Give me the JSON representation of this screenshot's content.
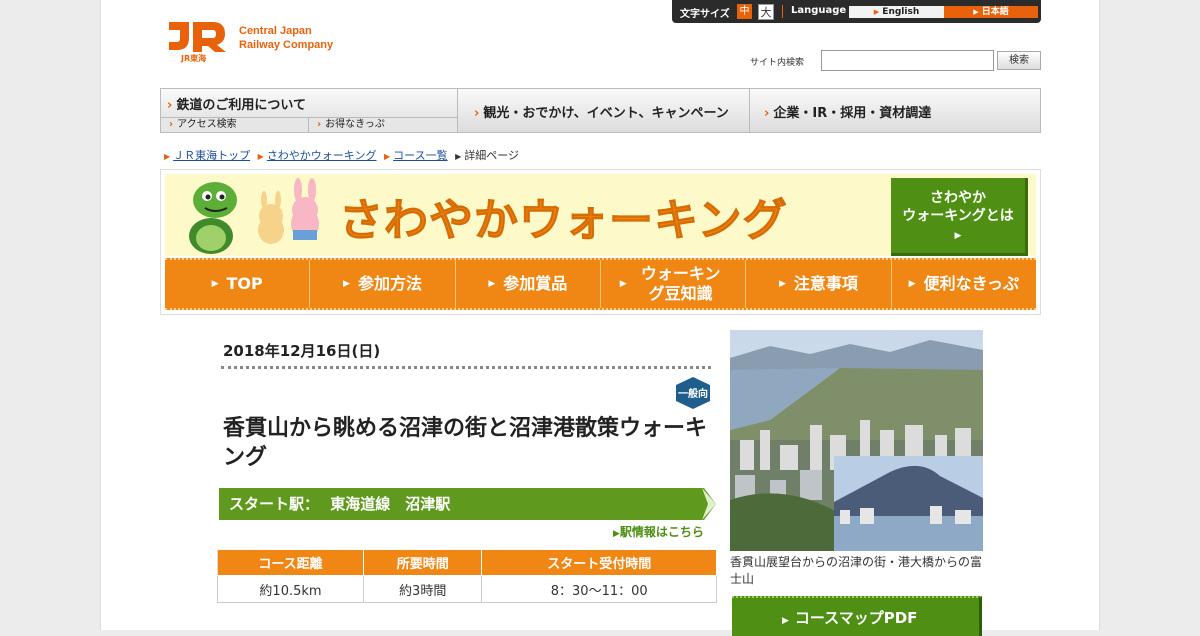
{
  "header": {
    "logo_mark_text": "JR東海",
    "company_name_line1": "Central Japan",
    "company_name_line2": "Railway Company",
    "font_size_label": "文字サイズ",
    "font_size_mid": "中",
    "font_size_large": "大",
    "language_label": "Language",
    "lang_english": "English",
    "lang_japanese": "日本語",
    "search_label": "サイト内検索",
    "search_value": "",
    "search_button": "検索"
  },
  "mainnav": {
    "railway_title": "鉄道のご利用について",
    "railway_sub1": "アクセス検索",
    "railway_sub2": "お得なきっぷ",
    "tourism": "観光・おでかけ、イベント、キャンペーン",
    "corporate": "企業・IR・採用・資材調達"
  },
  "breadcrumb": {
    "items": [
      "ＪＲ東海トップ",
      "さわやかウォーキング",
      "コース一覧"
    ],
    "current": "詳細ページ"
  },
  "banner": {
    "title": "さわやかウォーキング",
    "about_line1": "さわやか",
    "about_line2": "ウォーキングとは",
    "tabs": [
      "TOP",
      "参加方法",
      "参加賞品",
      "ウォーキング豆知識",
      "注意事項",
      "便利なきっぷ"
    ]
  },
  "course": {
    "date": "2018年12月16日(日)",
    "level_badge": "一般向",
    "title": "香貫山から眺める沼津の街と沼津港散策ウォーキング",
    "start_label": "スタート駅：",
    "start_station": "東海道線　沼津駅",
    "station_link": "駅情報はこちら",
    "table_headers": [
      "コース距離",
      "所要時間",
      "スタート受付時間"
    ],
    "table_values": [
      "約10.5km",
      "約3時間",
      "8：30～11：00"
    ]
  },
  "sidebar": {
    "photo_caption": "香貫山展望台からの沼津の街・港大橋からの富士山",
    "pdf_button": "コースマップPDF"
  },
  "colors": {
    "brand_orange": "#f08613",
    "green": "#4e8f14",
    "link_blue": "#1b4f9c"
  }
}
